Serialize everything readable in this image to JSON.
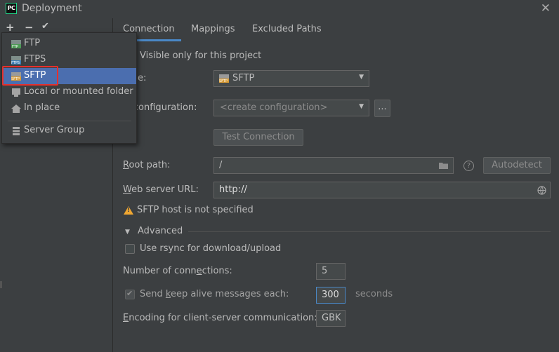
{
  "window": {
    "title": "Deployment",
    "app_icon_label": "PC"
  },
  "toolbar": {
    "add": "+",
    "remove": "−",
    "apply": "✔"
  },
  "menu": {
    "items": [
      {
        "label": "FTP",
        "icon": "ftp-icon"
      },
      {
        "label": "FTPS",
        "icon": "ftps-icon"
      },
      {
        "label": "SFTP",
        "icon": "sftp-icon",
        "selected": true
      },
      {
        "label": "Local or mounted folder",
        "icon": "folder-icon"
      },
      {
        "label": "In place",
        "icon": "home-icon"
      },
      {
        "label": "Server Group",
        "icon": "server-group-icon"
      }
    ]
  },
  "tabs": [
    {
      "label": "Connection",
      "active": true
    },
    {
      "label": "Mappings"
    },
    {
      "label": "Excluded Paths"
    }
  ],
  "form": {
    "visible_only": "Visible only for this project",
    "type_label": "e:",
    "type_value": "SFTP",
    "ssh_label": "H configuration:",
    "ssh_placeholder": "<create configuration>",
    "more": "...",
    "test_connection": "Test Connection",
    "root_path_label_u": "R",
    "root_path_label_rest": "oot path:",
    "root_path_value": "/",
    "help": "?",
    "autodetect": "Autodetect",
    "web_url_label_u": "W",
    "web_url_label_rest": "eb server URL:",
    "web_url_value": "http://",
    "warning": "SFTP host is not specified",
    "advanced": "Advanced",
    "rsync_label": "Use rsync for download/upload",
    "connections_label_a": "Number of conn",
    "connections_label_u": "e",
    "connections_label_b": "ctions:",
    "connections_value": "5",
    "keepalive_label_a": "Send ",
    "keepalive_label_u": "k",
    "keepalive_label_b": "eep alive messages each:",
    "keepalive_value": "300",
    "keepalive_unit": "seconds",
    "encoding_label_u": "E",
    "encoding_label_rest": "ncoding for client-server communication:",
    "encoding_value": "GBK"
  },
  "colors": {
    "background": "#3c3f41",
    "selection": "#4b6eaf",
    "accent": "#4a88c7",
    "warning": "#f0a732",
    "highlight": "#e5302d"
  }
}
